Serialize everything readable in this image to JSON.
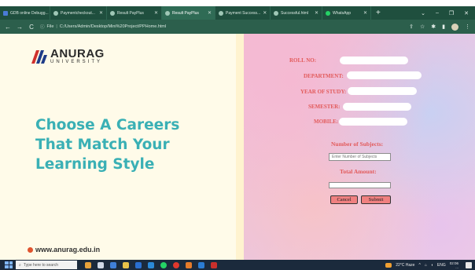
{
  "browser": {
    "tabs": [
      {
        "title": "GDB online Debugg...",
        "icon": "gdb-icon",
        "active": false
      },
      {
        "title": "Paymentcheckout...",
        "icon": "page-icon",
        "active": false
      },
      {
        "title": "Result PayPlus",
        "icon": "page-icon",
        "active": false
      },
      {
        "title": "Result PayPlus",
        "icon": "page-icon",
        "active": true
      },
      {
        "title": "Payment Success...",
        "icon": "page-icon",
        "active": false
      },
      {
        "title": "Successful.html",
        "icon": "page-icon",
        "active": false
      },
      {
        "title": "WhatsApp",
        "icon": "whatsapp-icon",
        "active": false
      }
    ],
    "new_tab_glyph": "+",
    "window_controls": {
      "minimize": "–",
      "maximize": "❐",
      "close": "✕"
    },
    "nav": {
      "back": "←",
      "forward": "→",
      "reload": "C"
    },
    "address": {
      "scheme_label": "File",
      "separator": "|",
      "path": "C:/Users/Admin/Desktop/Mini%20Project/PPHome.html"
    }
  },
  "left": {
    "logo_name": "ANURAG",
    "logo_sub": "UNIVERSITY",
    "headline_lines": [
      "Choose A Careers",
      "That Match Your",
      "Learning Style"
    ],
    "website": "www.anurag.edu.in"
  },
  "form": {
    "roll_label": "ROLL NO:",
    "department_label": "DEPARTMENT:",
    "year_label": "YEAR OF STUDY:",
    "semester_label": "SEMESTER:",
    "mobile_label": "MOBILE:",
    "subjects_heading": "Number of Subjects:",
    "subjects_placeholder": "Enter Number of Subjects",
    "total_heading": "Total Amount:",
    "cancel_label": "Cancel",
    "submit_label": "Submit"
  },
  "taskbar": {
    "search_placeholder": "Type here to search",
    "weather": "22°C Haze",
    "language": "ENG",
    "time": "02:06",
    "date": "..."
  },
  "colors": {
    "brand_teal": "#3ab0b5",
    "form_label_red": "#e25a5a",
    "button_salmon": "#f08080",
    "browser_green": "#1f4f3e"
  }
}
